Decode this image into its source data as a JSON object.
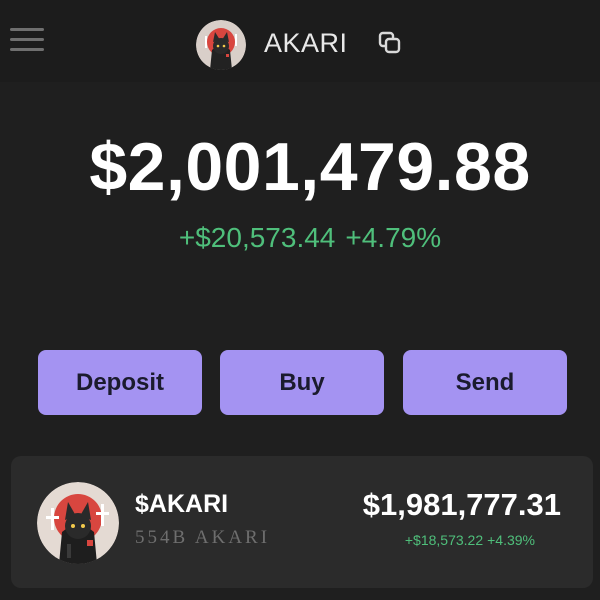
{
  "header": {
    "account_name": "AKARI",
    "menu_icon": "hamburger-menu-icon",
    "copy_icon": "copy-icon"
  },
  "portfolio": {
    "total_balance": "$2,001,479.88",
    "change_amount": "+$20,573.44",
    "change_percent": "+4.79%"
  },
  "actions": {
    "deposit_label": "Deposit",
    "buy_label": "Buy",
    "send_label": "Send"
  },
  "tokens": [
    {
      "symbol": "$AKARI",
      "amount": "554B AKARI",
      "value": "$1,981,777.31",
      "change_amount": "+$18,573.22",
      "change_percent": "+4.39%"
    }
  ],
  "colors": {
    "background": "#1f1f1f",
    "accent": "#a493f2",
    "positive": "#4fbf7b",
    "card": "#2b2b2b"
  }
}
